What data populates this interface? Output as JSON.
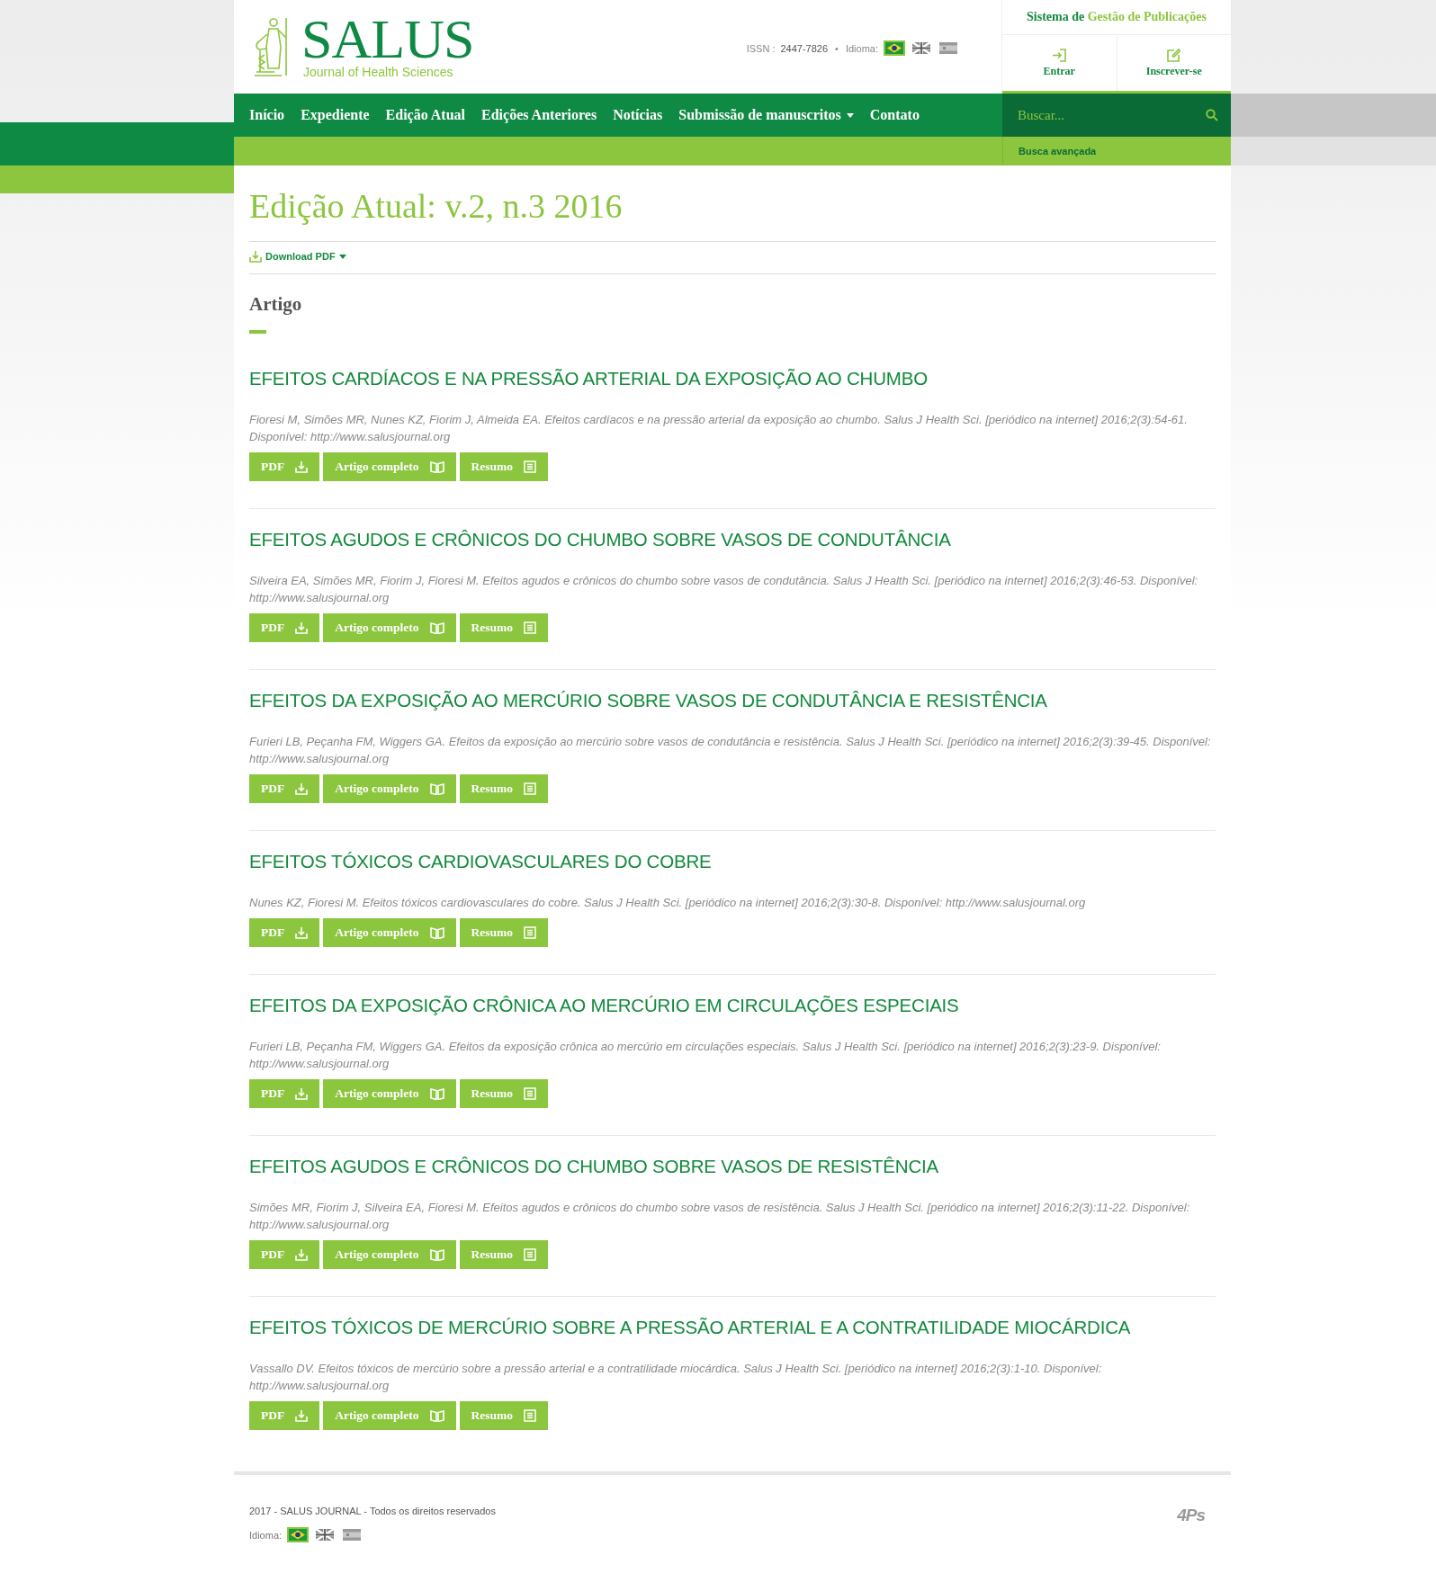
{
  "header": {
    "logo": {
      "title": "SALUS",
      "subtitle": "Journal of Health Sciences"
    },
    "issn": {
      "label": "ISSN :",
      "value": "2447-7826",
      "separator": "•"
    },
    "language": {
      "label": "Idioma:",
      "flags": [
        {
          "kind": "brazil",
          "selected": true
        },
        {
          "kind": "uk",
          "selected": false
        },
        {
          "kind": "spain",
          "selected": false
        }
      ]
    },
    "system": {
      "prefix": "Sistema de",
      "link": "Gestão de Publicações"
    },
    "actions": [
      {
        "kind": "login",
        "label": "Entrar"
      },
      {
        "kind": "register",
        "label": "Inscrever-se"
      }
    ]
  },
  "nav": {
    "items": [
      {
        "label": "Início",
        "dropdown": false
      },
      {
        "label": "Expediente",
        "dropdown": false
      },
      {
        "label": "Edição Atual",
        "dropdown": false
      },
      {
        "label": "Edições Anteriores",
        "dropdown": false
      },
      {
        "label": "Notícias",
        "dropdown": false
      },
      {
        "label": "Submissão de manuscritos",
        "dropdown": true
      },
      {
        "label": "Contato",
        "dropdown": false
      }
    ],
    "search": {
      "placeholder": "Buscar..."
    },
    "advanced_search": "Busca avançada"
  },
  "page": {
    "title": "Edição Atual: v.2, n.3 2016",
    "download": "Download PDF",
    "section": "Artigo"
  },
  "articles": [
    {
      "title": "EFEITOS CARDÍACOS E NA PRESSÃO ARTERIAL DA EXPOSIÇÃO AO CHUMBO",
      "citation": "Fioresi M, Simões MR, Nunes KZ, Fiorim J, Almeida EA. Efeitos cardíacos e na pressão arterial da exposição ao chumbo. Salus J Health Sci. [periódico na internet] 2016;2(3):54-61. Disponível: http://www.salusjournal.org",
      "buttons": [
        {
          "kind": "pdf",
          "label": "PDF"
        },
        {
          "kind": "full",
          "label": "Artigo completo"
        },
        {
          "kind": "abstract",
          "label": "Resumo"
        }
      ]
    },
    {
      "title": "EFEITOS AGUDOS E CRÔNICOS DO CHUMBO SOBRE VASOS DE CONDUTÂNCIA",
      "citation": "Silveira EA, Simões MR, Fiorim J, Fioresi M. Efeitos agudos e crônicos do chumbo sobre vasos de condutância. Salus J Health Sci. [periódico na internet] 2016;2(3):46-53. Disponível: http://www.salusjournal.org",
      "buttons": [
        {
          "kind": "pdf",
          "label": "PDF"
        },
        {
          "kind": "full",
          "label": "Artigo completo"
        },
        {
          "kind": "abstract",
          "label": "Resumo"
        }
      ]
    },
    {
      "title": "EFEITOS DA EXPOSIÇÃO AO MERCÚRIO SOBRE VASOS DE CONDUTÂNCIA E RESISTÊNCIA",
      "citation": "Furieri LB, Peçanha FM, Wiggers GA. Efeitos da exposição ao mercúrio sobre vasos de condutância e resistência. Salus J Health Sci. [periódico na internet] 2016;2(3):39-45. Disponível: http://www.salusjournal.org",
      "buttons": [
        {
          "kind": "pdf",
          "label": "PDF"
        },
        {
          "kind": "full",
          "label": "Artigo completo"
        },
        {
          "kind": "abstract",
          "label": "Resumo"
        }
      ]
    },
    {
      "title": "EFEITOS TÓXICOS CARDIOVASCULARES DO COBRE",
      "citation": "Nunes KZ, Fioresi M. Efeitos tóxicos cardiovasculares do cobre. Salus J Health Sci. [periódico na internet] 2016;2(3):30-8. Disponível: http://www.salusjournal.org",
      "buttons": [
        {
          "kind": "pdf",
          "label": "PDF"
        },
        {
          "kind": "full",
          "label": "Artigo completo"
        },
        {
          "kind": "abstract",
          "label": "Resumo"
        }
      ]
    },
    {
      "title": "EFEITOS DA EXPOSIÇÃO CRÔNICA AO MERCÚRIO EM CIRCULAÇÕES ESPECIAIS",
      "citation": "Furieri LB, Peçanha FM, Wiggers GA. Efeitos da exposição crônica ao mercúrio em circulações especiais. Salus J Health Sci. [periódico na internet] 2016;2(3):23-9. Disponível: http://www.salusjournal.org",
      "buttons": [
        {
          "kind": "pdf",
          "label": "PDF"
        },
        {
          "kind": "full",
          "label": "Artigo completo"
        },
        {
          "kind": "abstract",
          "label": "Resumo"
        }
      ]
    },
    {
      "title": "EFEITOS AGUDOS E CRÔNICOS DO CHUMBO SOBRE VASOS DE RESISTÊNCIA",
      "citation": "Simões MR, Fiorim J, Silveira EA, Fioresi M. Efeitos agudos e crônicos do chumbo sobre vasos de resistência. Salus J Health Sci. [periódico na internet] 2016;2(3):11-22. Disponível: http://www.salusjournal.org",
      "buttons": [
        {
          "kind": "pdf",
          "label": "PDF"
        },
        {
          "kind": "full",
          "label": "Artigo completo"
        },
        {
          "kind": "abstract",
          "label": "Resumo"
        }
      ]
    },
    {
      "title": "EFEITOS TÓXICOS DE MERCÚRIO SOBRE A PRESSÃO ARTERIAL E A CONTRATILIDADE MIOCÁRDICA",
      "citation": "Vassallo DV. Efeitos tóxicos de mercúrio sobre a pressão arterial e a contratilidade miocárdica. Salus J Health Sci. [periódico na internet] 2016;2(3):1-10. Disponível: http://www.salusjournal.org",
      "buttons": [
        {
          "kind": "pdf",
          "label": "PDF"
        },
        {
          "kind": "full",
          "label": "Artigo completo"
        },
        {
          "kind": "abstract",
          "label": "Resumo"
        }
      ]
    }
  ],
  "footer": {
    "copyright": "2017 - SALUS JOURNAL - Todos os direitos reservados",
    "language": {
      "label": "Idioma:",
      "flags": [
        {
          "kind": "brazil",
          "selected": true
        },
        {
          "kind": "uk",
          "selected": false
        },
        {
          "kind": "spain",
          "selected": false
        }
      ]
    },
    "brand": "4Ps"
  }
}
